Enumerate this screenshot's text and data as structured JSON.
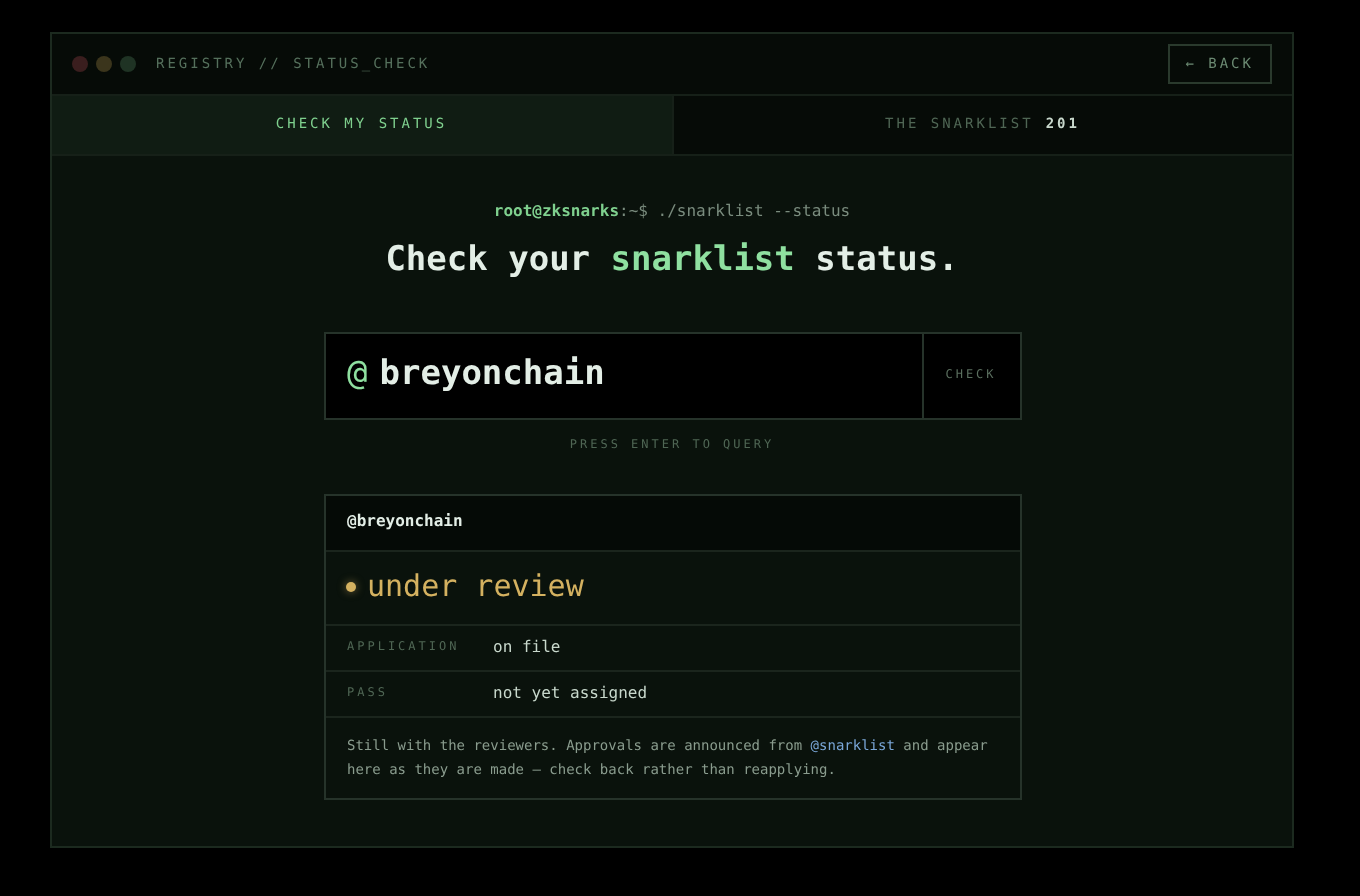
{
  "window": {
    "title": "REGISTRY // STATUS_CHECK",
    "back_button": "← BACK"
  },
  "tabs": [
    {
      "label": "CHECK MY STATUS",
      "selected": true
    },
    {
      "label": "THE SNARKLIST",
      "count": "201",
      "selected": false
    }
  ],
  "prompt": {
    "host": "root@zksnarks",
    "path": ":~$ ./snarklist --status"
  },
  "headline": [
    {
      "text": "Check your ",
      "highlight": false
    },
    {
      "text": "snarklist",
      "highlight": true
    },
    {
      "text": " status.",
      "highlight": false
    }
  ],
  "search": {
    "prefix": "@",
    "value": "breyonchain",
    "button": "CHECK",
    "hint": "PRESS ENTER TO QUERY"
  },
  "result": {
    "handle": "@breyonchain",
    "status": {
      "text": "under review",
      "kind": "pending"
    },
    "fields": [
      {
        "label": "APPLICATION",
        "value": "on file"
      },
      {
        "label": "PASS",
        "value": "not yet assigned"
      }
    ],
    "note_before": "Still with the reviewers. Approvals are announced from ",
    "note_link": "@snarklist",
    "note_after": " and appear here as they are made — check back rather than reapplying."
  }
}
